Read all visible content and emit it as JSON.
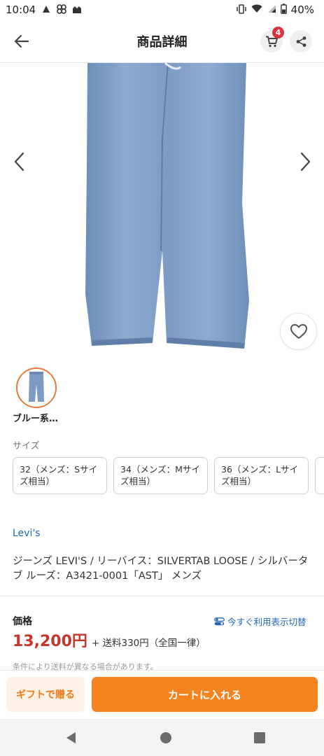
{
  "status_bar": {
    "time": "10:04",
    "battery": "40%"
  },
  "header": {
    "title": "商品詳細",
    "cart_count": "4"
  },
  "gallery": {
    "thumbnail_label": "ブルー系…"
  },
  "sizes": {
    "label": "サイズ",
    "options": [
      "32（メンズ：Sサイズ相当）",
      "34（メンズ：Mサイズ相当）",
      "36（メンズ：Lサイズ相当）"
    ]
  },
  "product": {
    "brand": "Levi's",
    "title": "ジーンズ LEVI'S / リーバイス：SILVERTAB LOOSE / シルバータブ ルーズ：A3421-0001「AST」 メンズ"
  },
  "price": {
    "label": "価格",
    "value": "13,200円",
    "shipping": "+ 送料330円（全国一律）",
    "toggle_label": "今すぐ利用表示切替",
    "note": "条件により送料が異なる場合があります。"
  },
  "actions": {
    "gift_label": "ギフトで贈る",
    "add_to_cart_label": "カートに入れる"
  },
  "colors": {
    "accent": "#f5841f",
    "link": "#1f67b2",
    "price": "#c0392b",
    "badge": "#d9343f"
  }
}
